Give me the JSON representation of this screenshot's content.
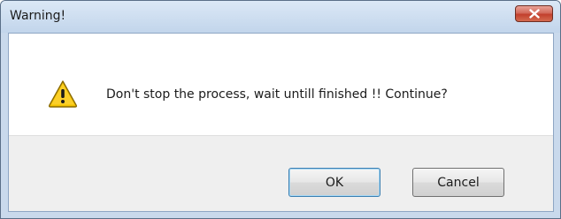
{
  "dialog": {
    "title": "Warning!",
    "message": "Don't stop the process, wait untill finished !! Continue?",
    "icon": "warning-icon",
    "close_icon": "close-icon"
  },
  "buttons": {
    "ok_label": "OK",
    "cancel_label": "Cancel"
  },
  "colors": {
    "title_bar": "#c9d9ec",
    "close_button": "#c2402d",
    "warning_fill": "#f5c400"
  }
}
